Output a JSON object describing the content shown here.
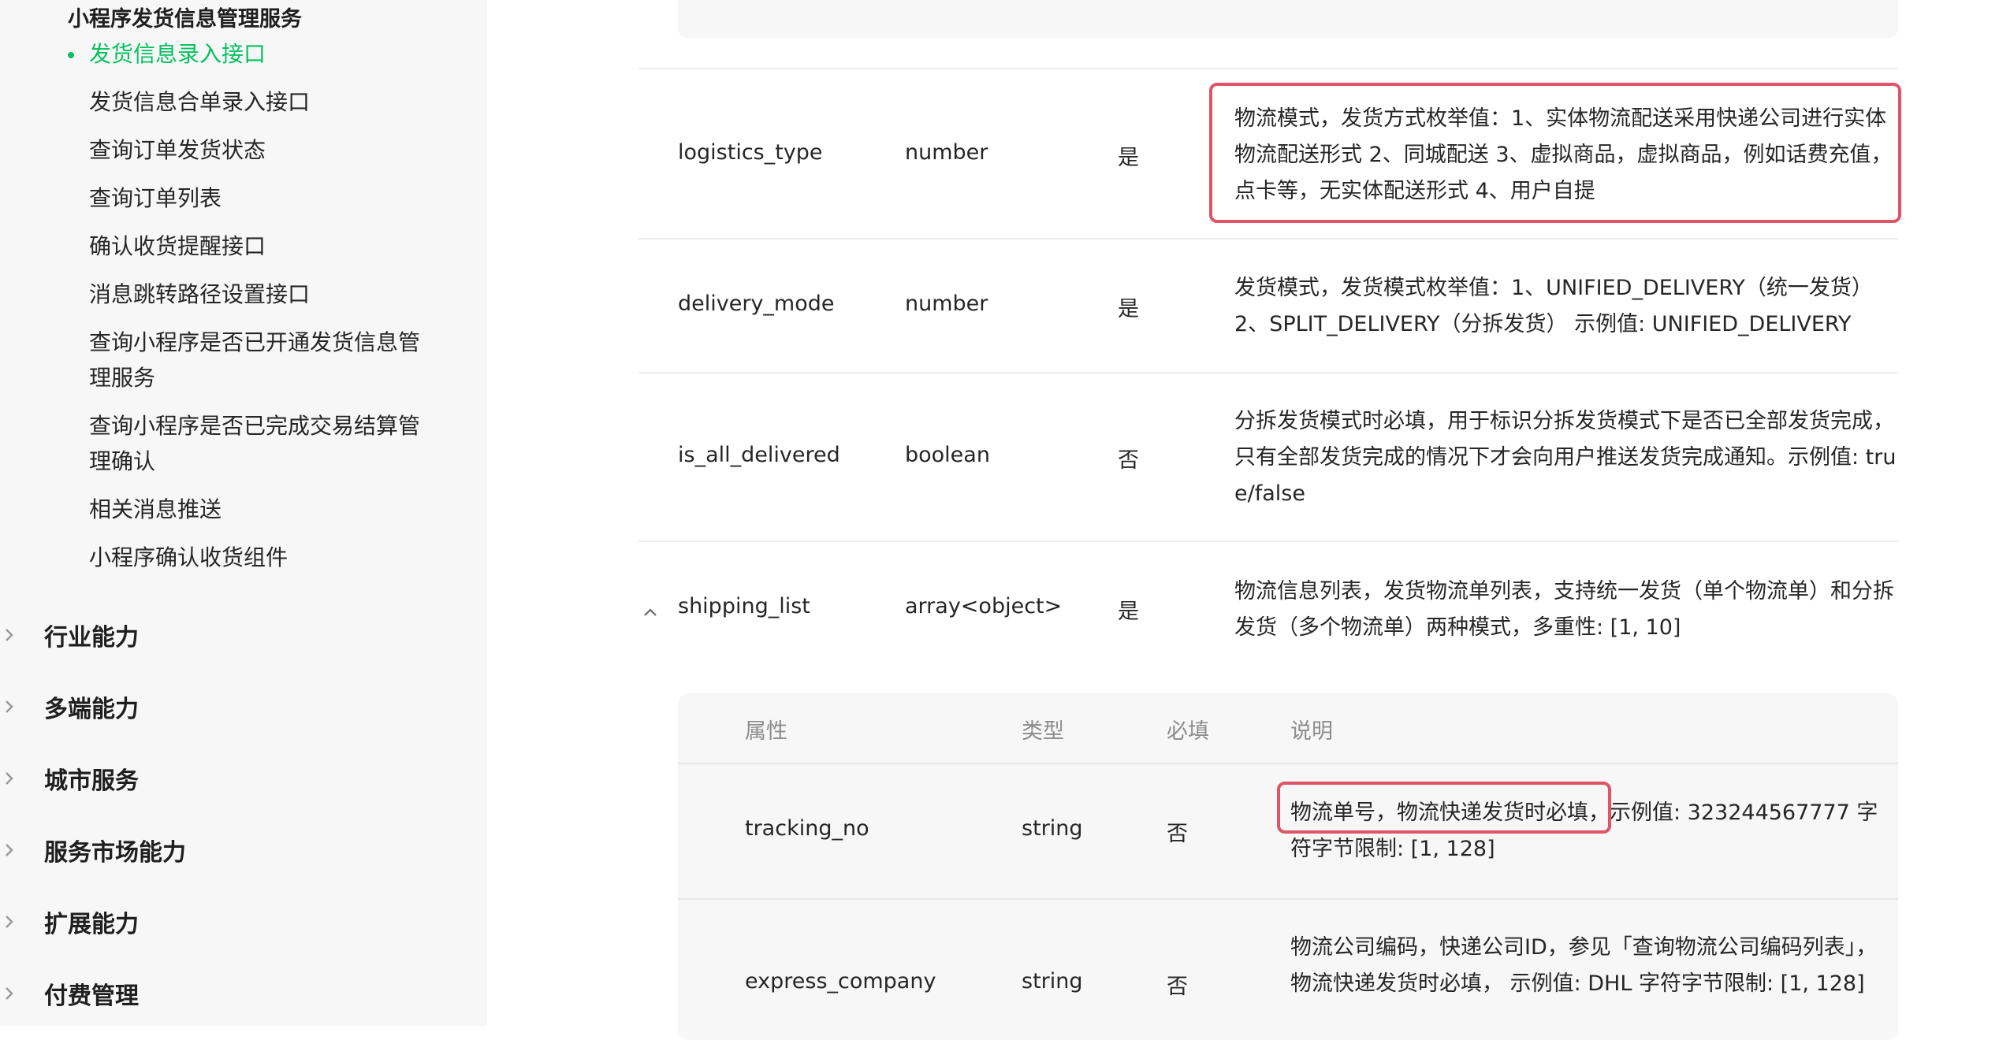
{
  "sidebar": {
    "section_title": "小程序发货信息管理服务",
    "items": [
      {
        "label": "发货信息录入接口",
        "active": true
      },
      {
        "label": "发货信息合单录入接口"
      },
      {
        "label": "查询订单发货状态"
      },
      {
        "label": "查询订单列表"
      },
      {
        "label": "确认收货提醒接口"
      },
      {
        "label": "消息跳转路径设置接口"
      },
      {
        "label": "查询小程序是否已开通发货信息管理服务"
      },
      {
        "label": "查询小程序是否已完成交易结算管理确认"
      },
      {
        "label": "相关消息推送"
      },
      {
        "label": "小程序确认收货组件"
      }
    ],
    "categories": [
      {
        "label": "行业能力",
        "icon": "chevron-right-icon"
      },
      {
        "label": "多端能力",
        "icon": "chevron-right-icon"
      },
      {
        "label": "城市服务",
        "icon": "chevron-right-icon"
      },
      {
        "label": "服务市场能力",
        "icon": "chevron-right-icon"
      },
      {
        "label": "扩展能力",
        "icon": "chevron-right-icon"
      },
      {
        "label": "付费管理",
        "icon": "chevron-right-icon"
      }
    ]
  },
  "params": {
    "rows": [
      {
        "name": "logistics_type",
        "type": "number",
        "required": "是",
        "desc": "物流模式，发货方式枚举值：1、实体物流配送采用快递公司进行实体物流配送形式 2、同城配送 3、虚拟商品，虚拟商品，例如话费充值，点卡等，无实体配送形式 4、用户自提"
      },
      {
        "name": "delivery_mode",
        "type": "number",
        "required": "是",
        "desc": "发货模式，发货模式枚举值：1、UNIFIED_DELIVERY（统一发货）2、SPLIT_DELIVERY（分拆发货） 示例值: UNIFIED_DELIVERY"
      },
      {
        "name": "is_all_delivered",
        "type": "boolean",
        "required": "否",
        "desc": "分拆发货模式时必填，用于标识分拆发货模式下是否已全部发货完成，只有全部发货完成的情况下才会向用户推送发货完成通知。示例值: true/false"
      },
      {
        "name": "shipping_list",
        "type": "array<object>",
        "required": "是",
        "desc": "物流信息列表，发货物流单列表，支持统一发货（单个物流单）和分拆发货（多个物流单）两种模式，多重性: [1, 10]"
      }
    ]
  },
  "sub_table": {
    "headers": {
      "name": "属性",
      "type": "类型",
      "required": "必填",
      "desc": "说明"
    },
    "rows": [
      {
        "name": "tracking_no",
        "type": "string",
        "required": "否",
        "desc_highlight": "物流单号，物流快递发货时必填，",
        "desc_rest": "示例值: 323244567777 字符字节限制: [1, 128]"
      },
      {
        "name": "express_company",
        "type": "string",
        "required": "否",
        "desc": "物流公司编码，快递公司ID，参见「查询物流公司编码列表」，物流快递发货时必填， 示例值: DHL 字符字节限制: [1, 128]"
      }
    ]
  },
  "colors": {
    "accent": "#07c160",
    "highlight_border": "#e05468"
  }
}
